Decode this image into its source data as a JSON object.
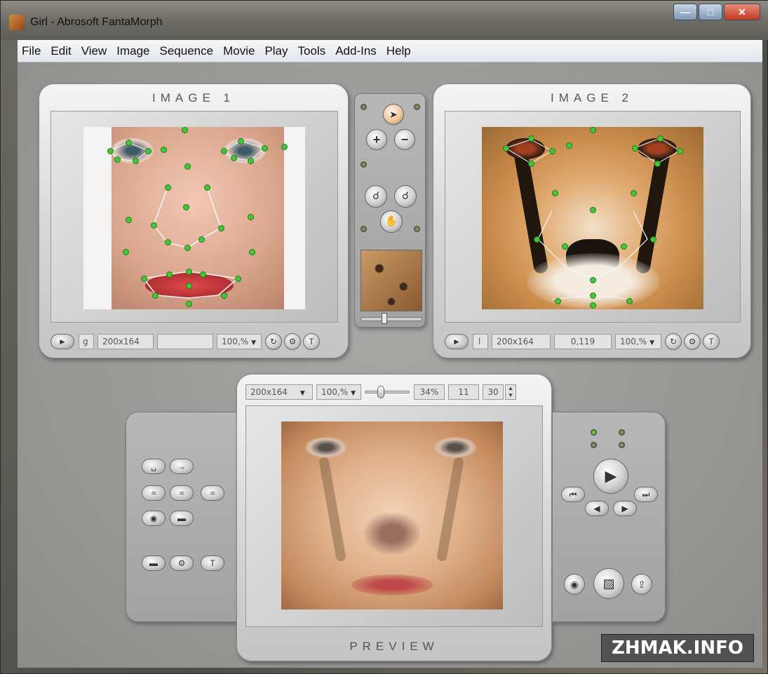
{
  "window": {
    "title": "Girl - Abrosoft FantaMorph"
  },
  "menu": [
    "File",
    "Edit",
    "View",
    "Image",
    "Sequence",
    "Movie",
    "Play",
    "Tools",
    "Add-Ins",
    "Help"
  ],
  "image1": {
    "title": "IMAGE 1",
    "key_field": "g",
    "size": "200x164",
    "coord": "",
    "zoom": "100,%"
  },
  "image2": {
    "title": "IMAGE 2",
    "key_field": "l",
    "size": "200x164",
    "coord": "0,119",
    "zoom": "100,%"
  },
  "preview": {
    "title": "PREVIEW",
    "size": "200x164",
    "zoom": "100,%",
    "progress_label": "34%",
    "frame": "11",
    "fps": "30",
    "slider_fraction": 0.34
  },
  "watermark": "ZHMAK.INFO",
  "colors": {
    "point": "#46c63a",
    "panel": "#d8d8d8",
    "background": "#9a9a98"
  },
  "icons": {
    "toolbar_center": [
      "select-arrow-icon",
      "add-point-icon",
      "remove-point-icon",
      "zoom-in-icon",
      "zoom-out-icon",
      "hand-icon"
    ],
    "left_panel": [
      "space-icon",
      "arrow-right-icon",
      "morph-1-icon",
      "morph-2-icon",
      "morph-3-icon",
      "eye-icon",
      "mask-icon",
      "tool-1-icon",
      "settings-icon",
      "text-icon"
    ],
    "right_panel": [
      "play-icon",
      "first-frame-icon",
      "last-frame-icon",
      "prev-frame-icon",
      "next-frame-icon",
      "camera-icon",
      "film-icon",
      "export-icon"
    ]
  }
}
